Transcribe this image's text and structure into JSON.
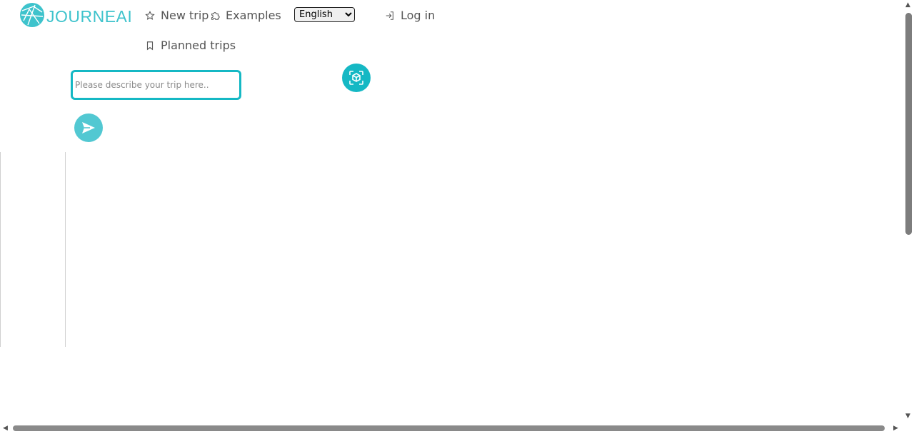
{
  "brand": {
    "name": "JOURNEAI",
    "color": "#3ec3cc"
  },
  "nav": {
    "new_trip": {
      "label": "New trip",
      "icon": "star-icon"
    },
    "examples": {
      "label": "Examples",
      "icon": "puzzle-icon"
    },
    "login": {
      "label": "Log in",
      "icon": "login-icon"
    },
    "planned_trips": {
      "label": "Planned trips",
      "icon": "bookmark-icon"
    }
  },
  "language": {
    "selected": "English"
  },
  "trip_input": {
    "placeholder": "Please describe your trip here..",
    "value": ""
  },
  "buttons": {
    "ar": {
      "icon": "cube-scan-icon",
      "color": "#15b8c4"
    },
    "send": {
      "icon": "send-icon",
      "color": "#52c8d2"
    }
  }
}
